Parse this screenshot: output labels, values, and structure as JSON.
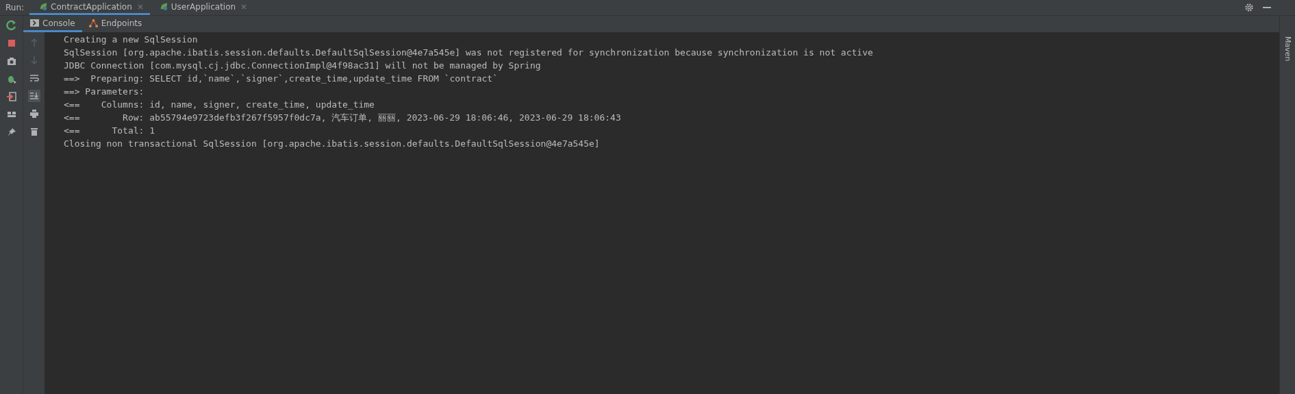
{
  "run_label": "Run:",
  "run_tabs": [
    {
      "label": "ContractApplication",
      "selected": true
    },
    {
      "label": "UserApplication",
      "selected": false
    }
  ],
  "sub_tabs": [
    {
      "label": "Console",
      "kind": "console",
      "selected": true
    },
    {
      "label": "Endpoints",
      "kind": "endpoints",
      "selected": false
    }
  ],
  "console_lines": [
    "Creating a new SqlSession",
    "SqlSession [org.apache.ibatis.session.defaults.DefaultSqlSession@4e7a545e] was not registered for synchronization because synchronization is not active",
    "JDBC Connection [com.mysql.cj.jdbc.ConnectionImpl@4f98ac31] will not be managed by Spring",
    "==>  Preparing: SELECT id,`name`,`signer`,create_time,update_time FROM `contract`",
    "==> Parameters: ",
    "<==    Columns: id, name, signer, create_time, update_time",
    "<==        Row: ab55794e9723defb3f267f5957f0dc7a, 汽车订单, 丽丽, 2023-06-29 18:06:46, 2023-06-29 18:06:43",
    "<==      Total: 1",
    "Closing non transactional SqlSession [org.apache.ibatis.session.defaults.DefaultSqlSession@4e7a545e]"
  ],
  "right_strip_label": "Maven"
}
